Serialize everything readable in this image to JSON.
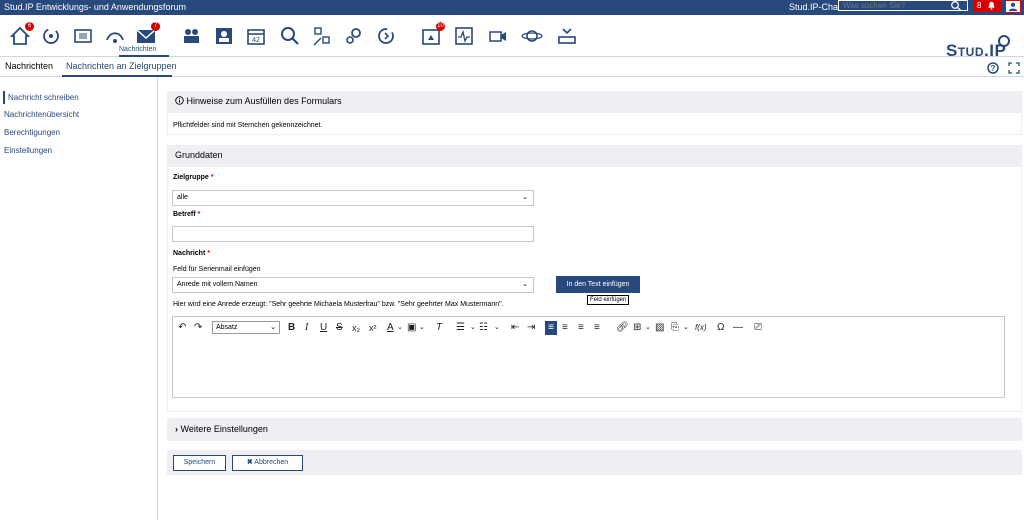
{
  "topbar": {
    "site_title": "Stud.IP Entwicklungs- und Anwendungsforum",
    "chat": "Stud.IP-Chat",
    "search_placeholder": "Was suchen Sie?",
    "notifications": "8"
  },
  "nav": {
    "active_label": "Nachrichten",
    "badge_messages": "7",
    "badge_start": "6",
    "badge_planner": "10"
  },
  "brand": {
    "logo": "Stud.IP"
  },
  "tabs": [
    {
      "label": "Nachrichten"
    },
    {
      "label": "Nachrichten an Zielgruppen"
    }
  ],
  "sidebar": {
    "items": [
      {
        "label": "Nachricht schreiben"
      },
      {
        "label": "Nachrichtenübersicht"
      },
      {
        "label": "Berechtigungen"
      },
      {
        "label": "Einstellungen"
      }
    ]
  },
  "hints": {
    "title": "Hinweise zum Ausfüllen des Formulars",
    "text": "Pflichtfelder sind mit Sternchen gekennzeichnet."
  },
  "form": {
    "section_title": "Grunddaten",
    "target_label": "Zielgruppe",
    "target_value": "alle",
    "subject_label": "Betreff",
    "subject_value": "",
    "message_label": "Nachricht",
    "serial_label": "Feld für Serienmail einfügen",
    "serial_value": "Anrede mit vollem Namen",
    "insert_button": "In den Text einfügen",
    "insert_tooltip": "Feld einfügen",
    "serial_hint": "Hier wird eine Anrede erzeugt: \"Sehr geehrte Michaela Musterfrau\" bzw. \"Sehr geehrter Max Mustermann\".",
    "required_mark": "*"
  },
  "editor": {
    "paragraph_select": "Absatz"
  },
  "more": {
    "title": "Weitere Einstellungen"
  },
  "actions": {
    "save": "Speichern",
    "cancel": "Abbrechen"
  },
  "colors": {
    "primary": "#28497c",
    "alert": "#d60000",
    "panel": "#eeeff2"
  }
}
